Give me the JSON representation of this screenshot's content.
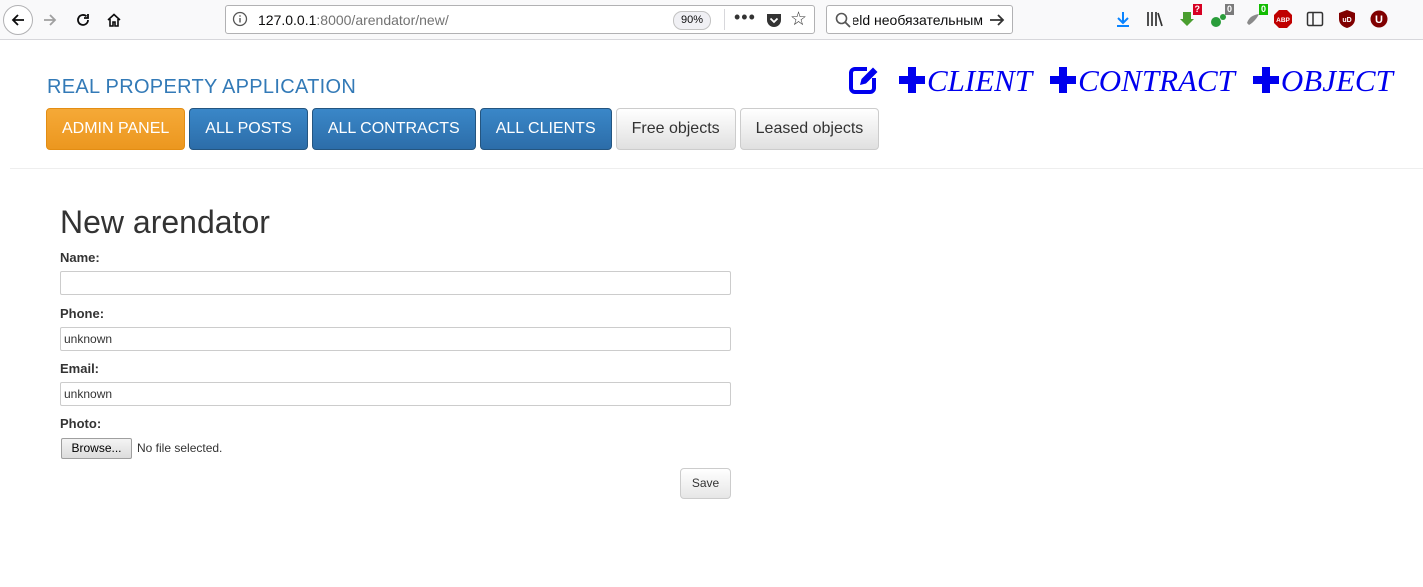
{
  "browser": {
    "url_host": "127.0.0.1",
    "url_path": ":8000/arendator/new/",
    "zoom": "90%",
    "search_text": "eld необязательным",
    "extensions": {
      "badge_1": "?",
      "badge_2": "0",
      "badge_3": "0",
      "abp": "ABP",
      "ublock": "uD",
      "ublock2": "U"
    },
    "colors": {
      "badge_red": "#d70022",
      "badge_gray": "#7a7a7a",
      "badge_green": "#12bc00"
    }
  },
  "header": {
    "brand": "REAL PROPERTY APPLICATION",
    "quick_links": [
      {
        "label": "CLIENT"
      },
      {
        "label": "CONTRACT"
      },
      {
        "label": "OBJECT"
      }
    ],
    "link_color": "#0000ee"
  },
  "nav": {
    "admin_panel": "ADMIN PANEL",
    "all_posts": "ALL POSTS",
    "all_contracts": "ALL CONTRACTS",
    "all_clients": "ALL CLIENTS",
    "free_objects": "Free objects",
    "leased_objects": "Leased objects"
  },
  "form": {
    "title": "New arendator",
    "name_label": "Name:",
    "name_value": "",
    "phone_label": "Phone:",
    "phone_value": "unknown",
    "email_label": "Email:",
    "email_value": "unknown",
    "photo_label": "Photo:",
    "browse_label": "Browse...",
    "file_status": "No file selected.",
    "save_label": "Save"
  }
}
